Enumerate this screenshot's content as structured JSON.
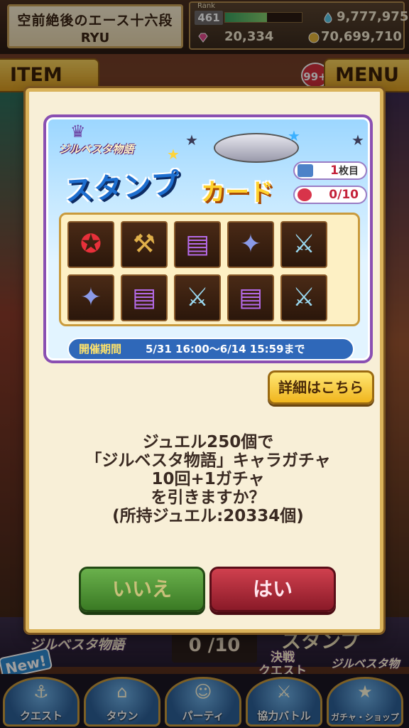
{
  "header": {
    "title": "空前絶後のエース十六段",
    "player_name": "RYU",
    "rank_label": "Rank",
    "rank": "461",
    "rank_progress": 0.55,
    "stamina": "9,777,975",
    "gems": "20,334",
    "coins": "70,699,710"
  },
  "tabs": {
    "item_label": "ITEM",
    "menu_label": "MENU",
    "badge": "99+"
  },
  "background": {
    "logo": "ジルベスタ物語",
    "counter": "0 /10",
    "stamp_text": "スタンプ",
    "new_badge": "New!",
    "decisive_quest": "決戦\nクエスト",
    "logo2": "ジルベスタ物語"
  },
  "bottom_nav": [
    {
      "label": "クエスト",
      "icon": "quest-icon"
    },
    {
      "label": "タウン",
      "icon": "town-icon"
    },
    {
      "label": "パーティ",
      "icon": "party-icon"
    },
    {
      "label": "協力バトル",
      "icon": "coop-battle-icon"
    },
    {
      "label": "ガチャ・ショップ",
      "icon": "gacha-shop-icon"
    }
  ],
  "dialog": {
    "card": {
      "logo": "ジルベスタ物語",
      "title_part1": "スタンプ",
      "title_part2": "カード",
      "sheet_count": "1",
      "sheet_unit": "枚目",
      "stamp_progress": "0/10",
      "stamps": [
        {
          "icon": "red-stamp-emblem-icon"
        },
        {
          "icon": "hammer-icon"
        },
        {
          "icon": "purple-book-icon"
        },
        {
          "icon": "star-crystal-icon"
        },
        {
          "icon": "sword-icon"
        },
        {
          "icon": "star-crystal-icon"
        },
        {
          "icon": "purple-book-icon"
        },
        {
          "icon": "sword-icon"
        },
        {
          "icon": "purple-book-icon"
        },
        {
          "icon": "sword-icon"
        }
      ],
      "period_label": "開催期間",
      "period_value": "5/31 16:00〜6/14 15:59まで"
    },
    "details_button": "詳細はこちら",
    "message_lines": [
      "ジュエル250個で",
      "「ジルベスタ物語」キャラガチャ",
      "10回+1ガチャ",
      "を引きますか？",
      "(所持ジュエル:20334個)"
    ],
    "no_button": "いいえ",
    "yes_button": "はい"
  },
  "colors": {
    "dialog_bg": "#f8efd7",
    "dialog_border": "#d9b25a",
    "no_button": "#4f9436",
    "yes_button": "#b02a3a",
    "card_border": "#8a4fb2",
    "period_bg": "#2f68b9"
  }
}
